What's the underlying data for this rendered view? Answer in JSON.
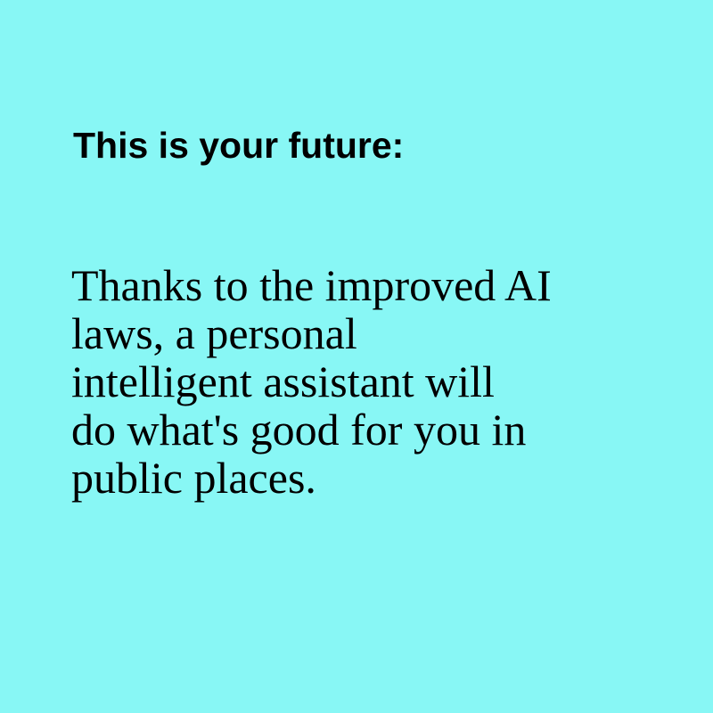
{
  "background_color": "#88f7f5",
  "text_color": "#000000",
  "heading": "This is your future:",
  "body": {
    "lines": [
      "Thanks to the improved AI",
      "laws, a personal",
      "intelligent assistant will",
      "do what's good for you in",
      "public places."
    ]
  }
}
